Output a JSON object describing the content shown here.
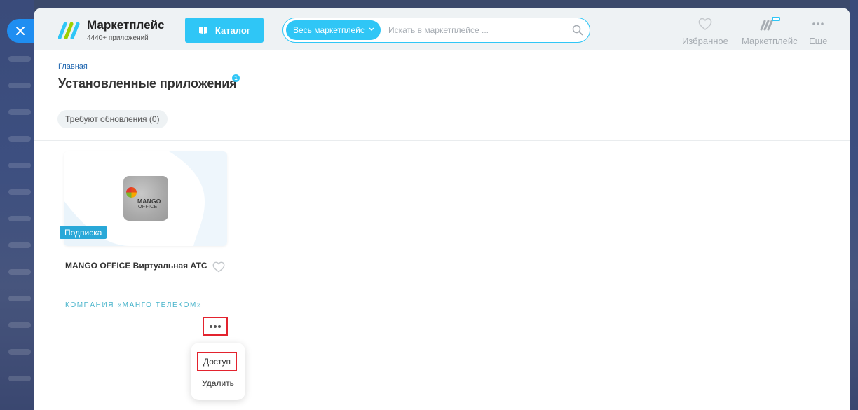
{
  "header": {
    "brand_title": "Маркетплейс",
    "brand_subtitle": "4440+ приложений",
    "catalog_label": "Каталог",
    "search_scope": "Весь маркетплейс",
    "search_placeholder": "Искать в маркетплейсе ...",
    "nav": [
      {
        "label": "Избранное",
        "icon": "heart-icon"
      },
      {
        "label": "Маркетплейс",
        "icon": "marketplace-icon"
      },
      {
        "label": "Еще",
        "icon": "more-dots-icon"
      }
    ]
  },
  "breadcrumb": "Главная",
  "page_title": "Установленные приложения",
  "title_badge": "1",
  "filter_chip": "Требуют обновления (0)",
  "app_card": {
    "name": "MANGO OFFICE Виртуальная АТС",
    "badge": "Подписка",
    "vendor": "Компания «Манго Телеком»",
    "logo_text_1": "MANGO",
    "logo_text_2": "OFFICE"
  },
  "menu": {
    "access": "Доступ",
    "delete": "Удалить"
  },
  "colors": {
    "accent": "#2fc6f6",
    "highlight": "#e3232e",
    "link": "#2067b0",
    "vendor": "#49b4cb"
  }
}
